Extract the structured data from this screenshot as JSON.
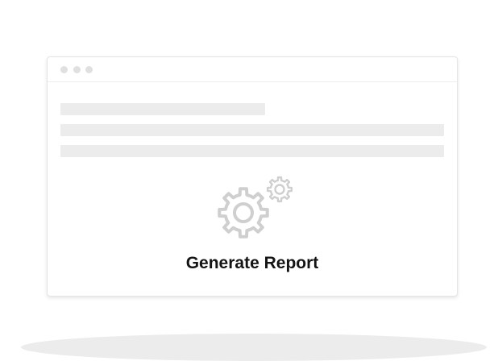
{
  "card": {
    "title": "Generate Report",
    "icon": "gears-icon"
  },
  "colors": {
    "window_dots": "#e0e0e0",
    "skeleton": "#ececec",
    "gear_stroke": "#cfcfcf",
    "floor_shadow": "#ececec",
    "title_text": "#141414"
  }
}
